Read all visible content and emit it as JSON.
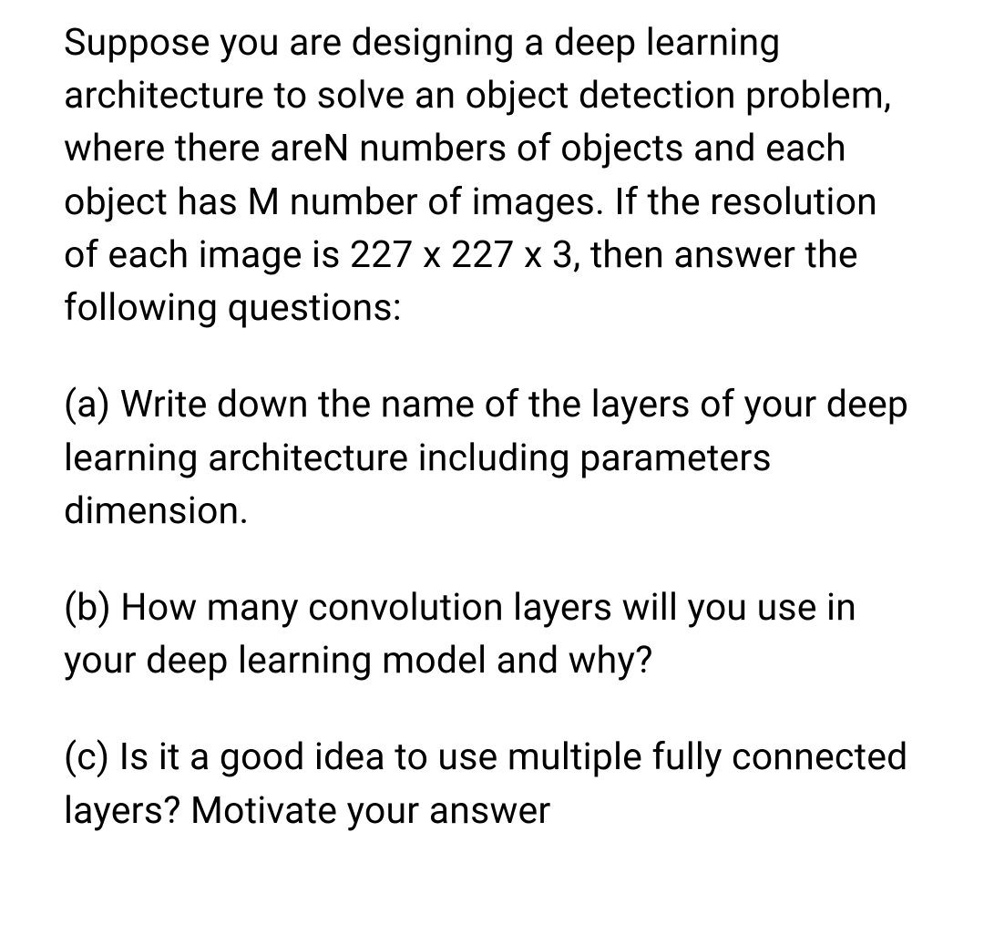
{
  "question": {
    "intro": "Suppose you are designing a deep learning architecture to solve an object detection problem, where there areN numbers of objects and each object has M number of images. If the resolution of each image is 227 x 227 x 3, then answer the following questions:",
    "parts": [
      "(a) Write down the name of the layers of your deep learning architecture including parameters dimension.",
      "(b) How many convolution layers will you use in your deep learning model and why?",
      "(c) Is it a good idea to use multiple fully connected layers? Motivate your answer"
    ]
  }
}
